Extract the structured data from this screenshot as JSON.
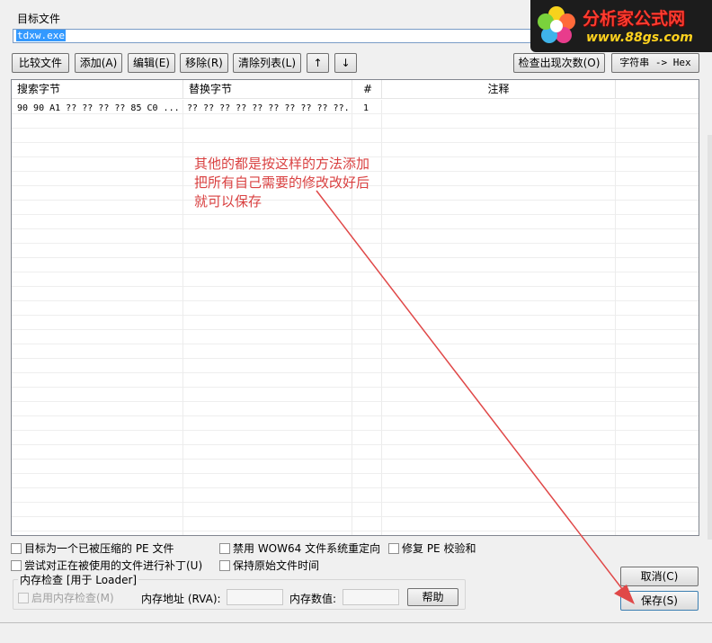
{
  "target": {
    "label": "目标文件",
    "value": "tdxw.exe"
  },
  "toolbar": {
    "compare": "比较文件",
    "add": "添加(A)",
    "edit": "编辑(E)",
    "remove": "移除(R)",
    "clear": "清除列表(L)",
    "up": "↑",
    "down": "↓",
    "check_count": "检查出现次数(O)",
    "string_hex": "字符串 -> Hex"
  },
  "table": {
    "columns": [
      "搜索字节",
      "替换字节",
      "#",
      "注释"
    ],
    "rows": [
      {
        "search": "90 90 A1 ?? ?? ?? ?? 85 C0 ...",
        "replace": "?? ?? ?? ?? ?? ?? ?? ?? ?? ??...",
        "count": "1",
        "comment": ""
      }
    ]
  },
  "annotation": {
    "lines": [
      "其他的都是按这样的方法添加",
      "把所有自己需要的修改改好后",
      "就可以保存"
    ],
    "color": "#d94040"
  },
  "options": {
    "packed_pe": "目标为一个已被压缩的 PE 文件",
    "disable_wow64": "禁用 WOW64 文件系统重定向",
    "fix_pe_checksum": "修复 PE 校验和",
    "patch_in_use": "尝试对正在被使用的文件进行补丁(U)",
    "keep_time": "保持原始文件时间"
  },
  "memory_check": {
    "title": "内存检查 [用于 Loader]",
    "enable": "启用内存检查(M)",
    "address_label": "内存地址 (RVA):",
    "value_label": "内存数值:",
    "help": "帮助"
  },
  "actions": {
    "cancel": "取消(C)",
    "save": "保存(S)"
  },
  "logo": {
    "title": "分析家公式网",
    "url": "www.88gs.com"
  }
}
